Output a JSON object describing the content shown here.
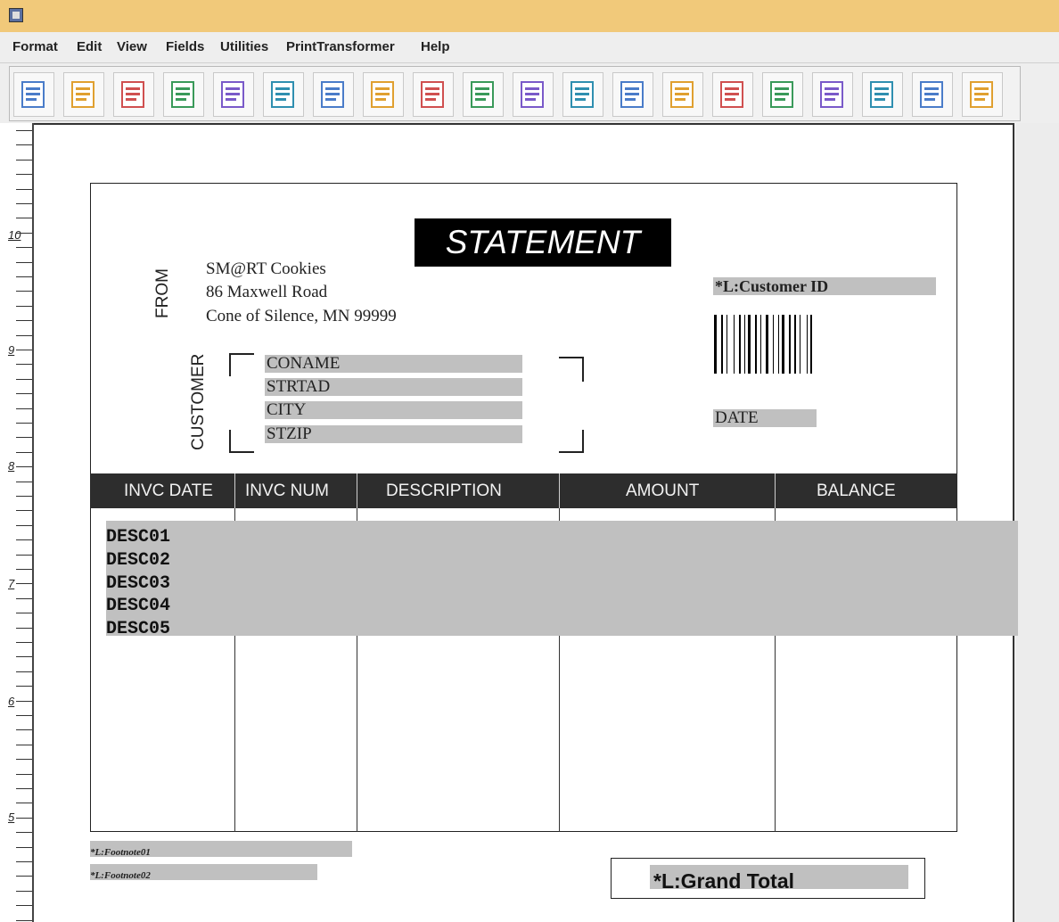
{
  "menu": [
    "Format",
    "Edit",
    "View",
    "Fields",
    "Utilities",
    "PrintTransformer",
    "Help"
  ],
  "toolbar_icons": [
    "new-form-icon",
    "open-folder-icon",
    "save-icon",
    "print-icon",
    "database-icon",
    "barcode-field-icon",
    "copy-icon",
    "text-field-icon",
    "text-box-icon",
    "box-icon",
    "line-icon",
    "new-field-icon",
    "field-list-icon",
    "properties-icon",
    "list-icon",
    "grid-icon",
    "remove-icon",
    "select-icon",
    "undo-icon",
    "redo-icon"
  ],
  "ruler": {
    "labels": [
      "10",
      "9",
      "8",
      "7",
      "6",
      "5"
    ]
  },
  "form": {
    "title": "STATEMENT",
    "from_label": "FROM",
    "from_lines": [
      "SM@RT Cookies",
      "86 Maxwell Road",
      "Cone of Silence, MN  99999"
    ],
    "customer_label": "CUSTOMER",
    "customer_fields": [
      "CONAME",
      "STRTAD",
      "CITY",
      "STZIP"
    ],
    "customer_id_field": "*L:Customer ID",
    "date_field": "DATE",
    "columns": [
      "INVC DATE",
      "INVC NUM",
      "DESCRIPTION",
      "AMOUNT",
      "BALANCE"
    ],
    "desc_lines": [
      "DESC01",
      "DESC02",
      "DESC03",
      "DESC04",
      "DESC05"
    ],
    "footnotes": [
      "*L:Footnote01",
      "*L:Footnote02"
    ],
    "grand_total_field": "*L:Grand Total"
  },
  "colors": {
    "titlebar": "#f1c97a",
    "field_gray": "#c0c0c0",
    "header_bar": "#2d2d2d"
  }
}
